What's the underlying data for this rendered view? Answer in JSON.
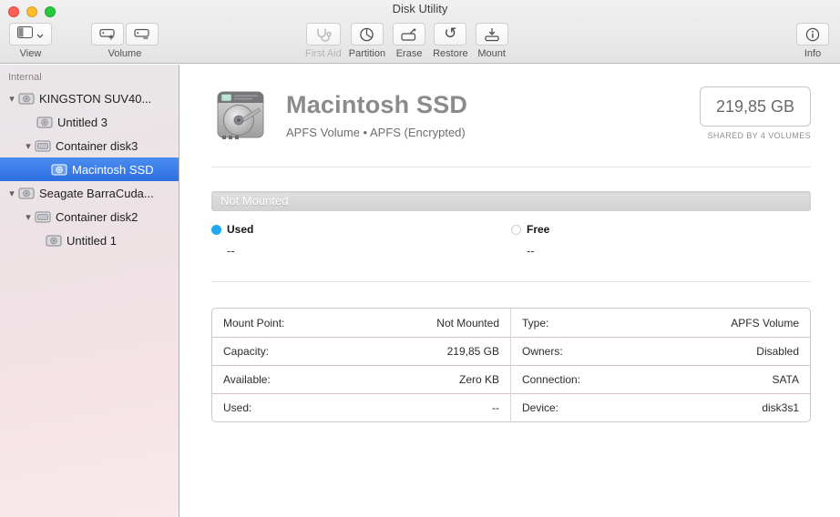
{
  "window": {
    "title": "Disk Utility"
  },
  "toolbar": {
    "view": {
      "label": "View"
    },
    "volume": {
      "label": "Volume"
    },
    "actions": [
      {
        "label": "First Aid",
        "enabled": false
      },
      {
        "label": "Partition",
        "enabled": true
      },
      {
        "label": "Erase",
        "enabled": true
      },
      {
        "label": "Restore",
        "enabled": true
      },
      {
        "label": "Mount",
        "enabled": true
      }
    ],
    "info": {
      "label": "Info"
    }
  },
  "sidebar": {
    "section_label": "Internal",
    "selection_color": "#3175e1",
    "items": [
      {
        "label": "KINGSTON SUV40...",
        "type": "disk",
        "level": 0,
        "expanded": true,
        "selected": false
      },
      {
        "label": "Untitled 3",
        "type": "volume",
        "level": 1,
        "selected": false
      },
      {
        "label": "Container disk3",
        "type": "container",
        "level": 1,
        "expanded": true,
        "selected": false
      },
      {
        "label": "Macintosh SSD",
        "type": "volume",
        "level": 2,
        "selected": true
      },
      {
        "label": "Seagate BarraCuda...",
        "type": "disk",
        "level": 0,
        "expanded": true,
        "selected": false
      },
      {
        "label": "Container disk2",
        "type": "container",
        "level": 1,
        "expanded": true,
        "selected": false
      },
      {
        "label": "Untitled 1",
        "type": "volume",
        "level": 2,
        "selected": false
      }
    ]
  },
  "main": {
    "title": "Macintosh SSD",
    "subtitle": "APFS Volume • APFS (Encrypted)",
    "capacity_badge": "219,85 GB",
    "shared_note": "SHARED BY 4 VOLUMES",
    "usage_bar": {
      "label": "Not Mounted"
    },
    "legend": [
      {
        "label": "Used",
        "value": "--",
        "color": "#1fa8f2"
      },
      {
        "label": "Free",
        "value": "--",
        "color": "#ffffff"
      }
    ],
    "details": {
      "left": [
        {
          "label": "Mount Point:",
          "value": "Not Mounted"
        },
        {
          "label": "Capacity:",
          "value": "219,85 GB"
        },
        {
          "label": "Available:",
          "value": "Zero KB"
        },
        {
          "label": "Used:",
          "value": "--"
        }
      ],
      "right": [
        {
          "label": "Type:",
          "value": "APFS Volume"
        },
        {
          "label": "Owners:",
          "value": "Disabled"
        },
        {
          "label": "Connection:",
          "value": "SATA"
        },
        {
          "label": "Device:",
          "value": "disk3s1"
        }
      ]
    }
  }
}
